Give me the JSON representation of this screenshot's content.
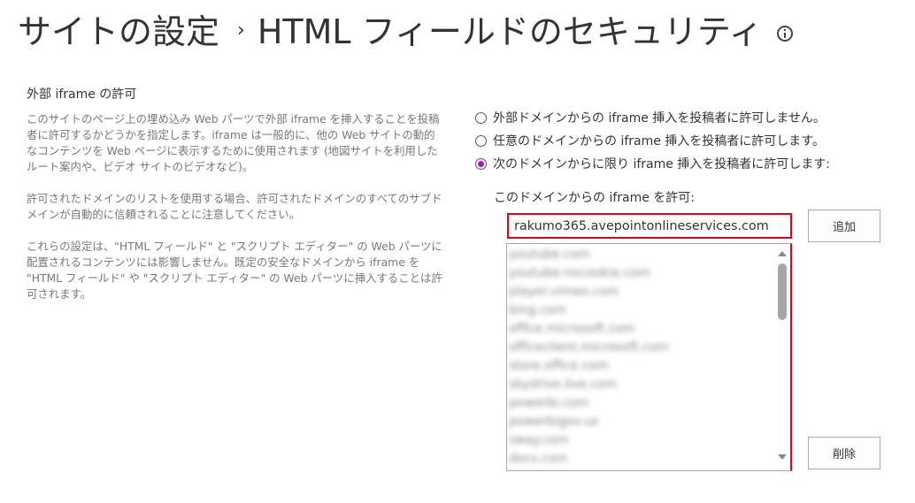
{
  "header": {
    "parent_title": "サイトの設定",
    "separator": "›",
    "page_title": "HTML フィールドのセキュリティ",
    "info_icon": "info-icon"
  },
  "section": {
    "title": "外部 iframe の許可",
    "paragraphs": [
      "このサイトのページ上の埋め込み Web パーツで外部 iframe を挿入することを投稿者に許可するかどうかを指定します。iframe は一般的に、他の Web サイトの動的なコンテンツを Web ページに表示するために使用されます (地図サイトを利用したルート案内や、ビデオ サイトのビデオなど)。",
      "許可されたドメインのリストを使用する場合、許可されたドメインのすべてのサブドメインが自動的に信頼されることに注意してください。",
      "これらの設定は、\"HTML フィールド\" と \"スクリプト エディター\" の Web パーツに配置されるコンテンツには影響しません。既定の安全なドメインから iframe を \"HTML フィールド\" や \"スクリプト エディター\" の Web パーツに挿入することは許可されます。"
    ]
  },
  "options": {
    "radios": [
      {
        "label": "外部ドメインからの iframe 挿入を投稿者に許可しません。",
        "checked": false
      },
      {
        "label": "任意のドメインからの iframe 挿入を投稿者に許可します。",
        "checked": false
      },
      {
        "label": "次のドメインからに限り iframe 挿入を投稿者に許可します:",
        "checked": true
      }
    ],
    "allow_label": "このドメインからの iframe を許可:",
    "domain_input_value": "rakumo365.avepointonlineservices.com",
    "add_button": "追加",
    "remove_button": "削除",
    "domain_list": [
      "youtube.com",
      "youtube-nocookie.com",
      "player.vimeo.com",
      "bing.com",
      "office.microsoft.com",
      "officeclient.microsoft.com",
      "store.office.com",
      "skydrive.live.com",
      "powerbi.com",
      "powerbigov.us",
      "sway.com",
      "docs.com"
    ]
  },
  "colors": {
    "accent_radio": "#8a2da5",
    "highlight_border": "#e0001b"
  }
}
